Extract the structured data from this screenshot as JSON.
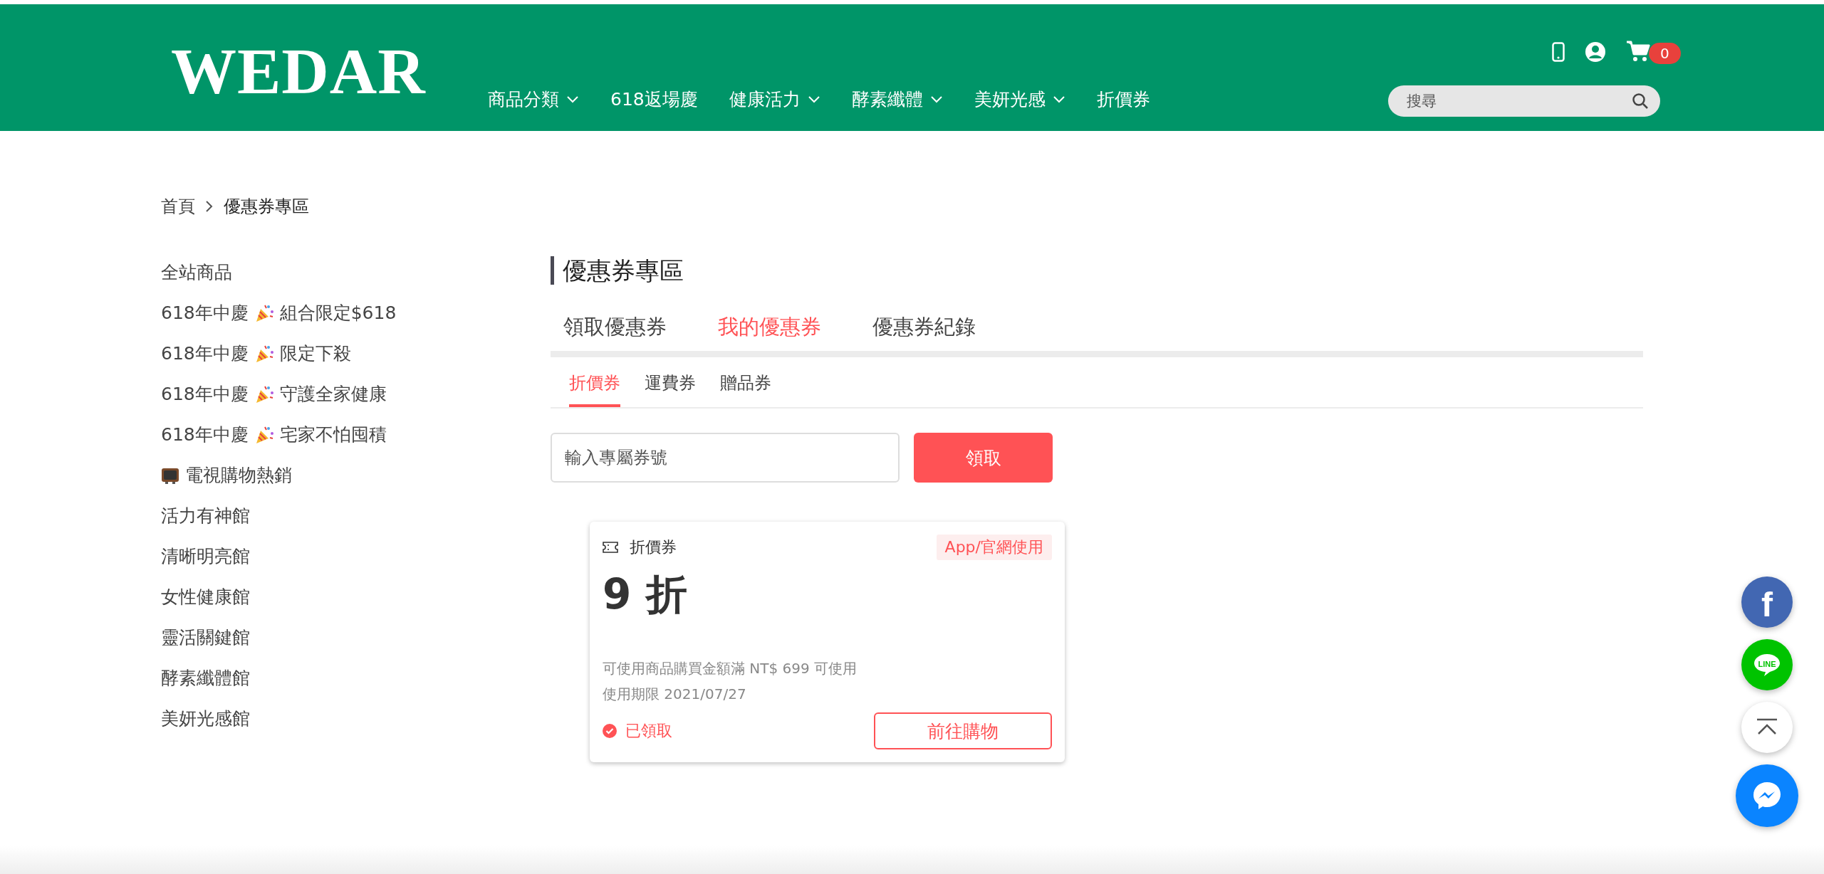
{
  "header": {
    "logo": "WEDAR",
    "nav": [
      {
        "label": "商品分類",
        "dropdown": true
      },
      {
        "label": "618返場慶",
        "dropdown": false
      },
      {
        "label": "健康活力",
        "dropdown": true
      },
      {
        "label": "酵素纖體",
        "dropdown": true
      },
      {
        "label": "美妍光感",
        "dropdown": true
      },
      {
        "label": "折價券",
        "dropdown": false
      }
    ],
    "cart_count": "0",
    "search": {
      "placeholder": "搜尋"
    }
  },
  "breadcrumb": [
    "首頁",
    "優惠券專區"
  ],
  "sidebar": {
    "items": [
      {
        "kind": "plain",
        "text": "全站商品"
      },
      {
        "kind": "party",
        "lead": "618年中慶",
        "text": "組合限定$618"
      },
      {
        "kind": "party",
        "lead": "618年中慶",
        "text": "限定下殺"
      },
      {
        "kind": "party",
        "lead": "618年中慶",
        "text": "守護全家健康"
      },
      {
        "kind": "party",
        "lead": "618年中慶",
        "text": "宅家不怕囤積"
      },
      {
        "kind": "tv",
        "text": "電視購物熱銷"
      },
      {
        "kind": "plain",
        "text": "活力有神館"
      },
      {
        "kind": "plain",
        "text": "清晰明亮館"
      },
      {
        "kind": "plain",
        "text": "女性健康館"
      },
      {
        "kind": "plain",
        "text": "靈活關鍵館"
      },
      {
        "kind": "plain",
        "text": "酵素纖體館"
      },
      {
        "kind": "plain",
        "text": "美妍光感館"
      }
    ]
  },
  "title": "優惠券專區",
  "tabs": [
    {
      "label": "領取優惠券",
      "selected": false
    },
    {
      "label": "我的優惠券",
      "selected": true
    },
    {
      "label": "優惠券紀錄",
      "selected": false
    }
  ],
  "subtabs": [
    {
      "label": "折價券",
      "selected": true
    },
    {
      "label": "運費券",
      "selected": false
    },
    {
      "label": "贈品券",
      "selected": false
    }
  ],
  "code_input": {
    "placeholder": "輸入專屬券號"
  },
  "claim_button": "領取",
  "coupons": [
    {
      "type": "折價券",
      "tag": "App/官網使用",
      "value": "9 折",
      "condition": "可使用商品購買金額滿 NT$ 699 可使用",
      "expiry": "使用期限 2021/07/27",
      "claimed": true,
      "status": "已領取",
      "action": "前往購物"
    }
  ],
  "floating": {
    "facebook_glyph": "f",
    "line_label": "LINE"
  }
}
